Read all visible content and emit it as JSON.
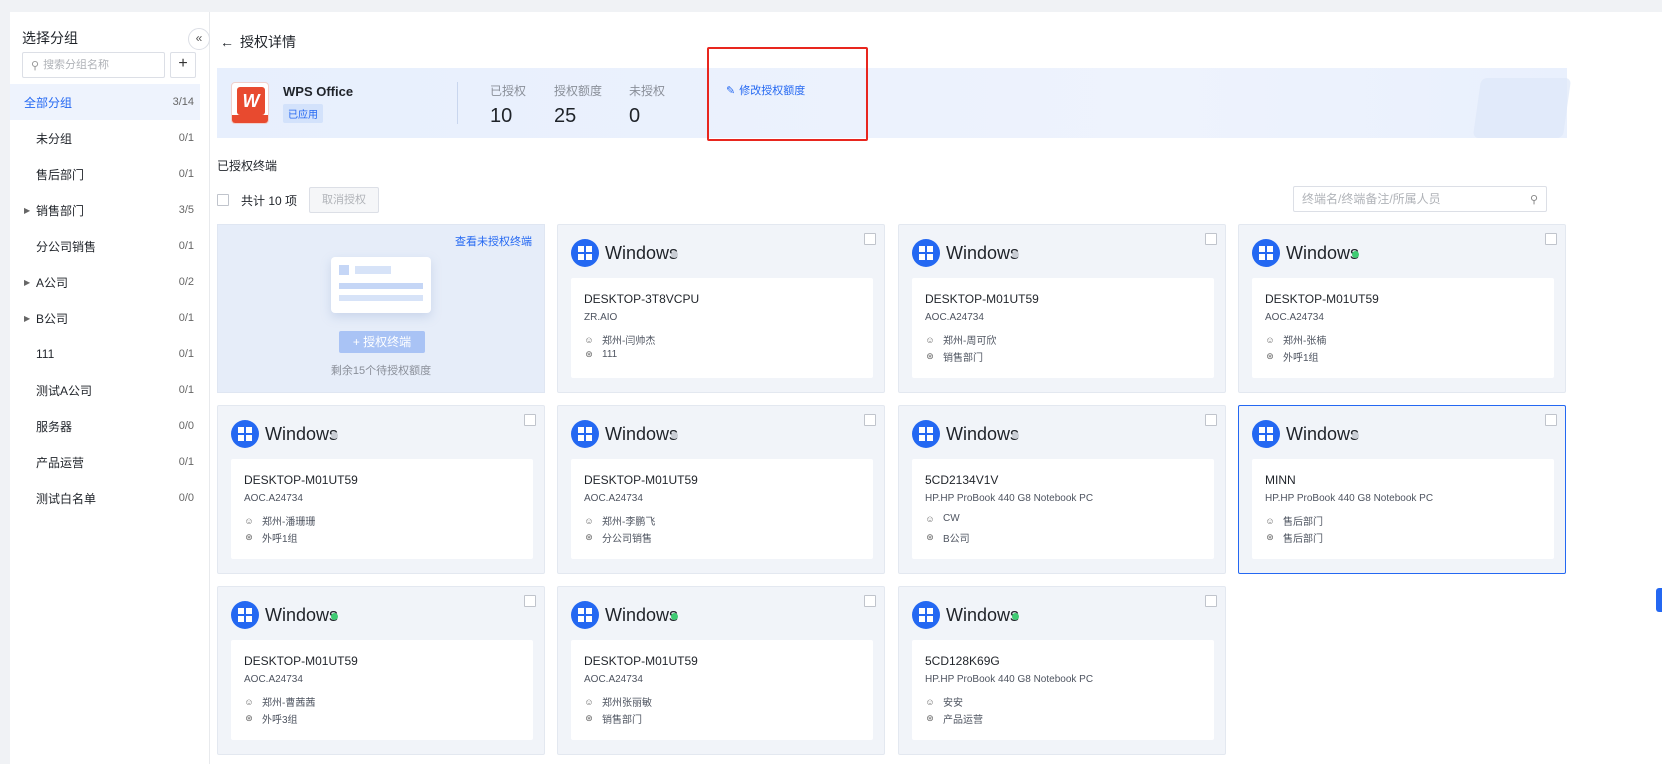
{
  "sidebar": {
    "title": "选择分组",
    "collapse_icon": "«",
    "search_placeholder": "搜索分组名称",
    "add_label": "+",
    "groups": [
      {
        "name": "全部分组",
        "count": "3/14",
        "active": true,
        "expandable": false
      },
      {
        "name": "未分组",
        "count": "0/1",
        "expandable": false
      },
      {
        "name": "售后部门",
        "count": "0/1",
        "expandable": false
      },
      {
        "name": "销售部门",
        "count": "3/5",
        "expandable": true
      },
      {
        "name": "分公司销售",
        "count": "0/1",
        "expandable": false
      },
      {
        "name": "A公司",
        "count": "0/2",
        "expandable": true
      },
      {
        "name": "B公司",
        "count": "0/1",
        "expandable": true
      },
      {
        "name": "111",
        "count": "0/1",
        "expandable": false
      },
      {
        "name": "测试A公司",
        "count": "0/1",
        "expandable": false
      },
      {
        "name": "服务器",
        "count": "0/0",
        "expandable": false
      },
      {
        "name": "产品运营",
        "count": "0/1",
        "expandable": false
      },
      {
        "name": "测试白名单",
        "count": "0/0",
        "expandable": false
      }
    ]
  },
  "header": {
    "back_label": "授权详情"
  },
  "app": {
    "name": "WPS Office",
    "status_tag": "已应用",
    "stats": [
      {
        "label": "已授权",
        "value": "10"
      },
      {
        "label": "授权额度",
        "value": "25"
      },
      {
        "label": "未授权",
        "value": "0"
      }
    ],
    "edit_label": "修改授权额度"
  },
  "section": {
    "title": "已授权终端",
    "total_label": "共计 10 项",
    "cancel_label": "取消授权",
    "search_placeholder": "终端名/终端备注/所属人员"
  },
  "auth_card": {
    "view_link": "查看未授权终端",
    "button_label": "授权终端",
    "note": "剩余15个待授权额度"
  },
  "terminals": [
    {
      "os": "Windows",
      "online": false,
      "host": "DESKTOP-3T8VCPU",
      "model": "ZR.AIO",
      "user": "郑州-闫帅杰",
      "group": "111",
      "selected": false
    },
    {
      "os": "Windows",
      "online": false,
      "host": "DESKTOP-M01UT59",
      "model": "AOC.A24734",
      "user": "郑州-周可欣",
      "group": "销售部门",
      "selected": false
    },
    {
      "os": "Windows",
      "online": true,
      "host": "DESKTOP-M01UT59",
      "model": "AOC.A24734",
      "user": "郑州-张楠",
      "group": "外呼1组",
      "selected": false
    },
    {
      "os": "Windows",
      "online": false,
      "host": "DESKTOP-M01UT59",
      "model": "AOC.A24734",
      "user": "郑州-潘珊珊",
      "group": "外呼1组",
      "selected": false
    },
    {
      "os": "Windows",
      "online": false,
      "host": "DESKTOP-M01UT59",
      "model": "AOC.A24734",
      "user": "郑州-李鹏飞",
      "group": "分公司销售",
      "selected": false
    },
    {
      "os": "Windows",
      "online": false,
      "host": "5CD2134V1V",
      "model": "HP.HP ProBook 440 G8 Notebook PC",
      "user": "CW",
      "group": "B公司",
      "selected": false
    },
    {
      "os": "Windows",
      "online": false,
      "host": "MINN",
      "model": "HP.HP ProBook 440 G8 Notebook PC",
      "user": "售后部门",
      "group": "售后部门",
      "selected": true
    },
    {
      "os": "Windows",
      "online": true,
      "host": "DESKTOP-M01UT59",
      "model": "AOC.A24734",
      "user": "郑州-曹茜茜",
      "group": "外呼3组",
      "selected": false
    },
    {
      "os": "Windows",
      "online": true,
      "host": "DESKTOP-M01UT59",
      "model": "AOC.A24734",
      "user": "郑州张丽敏",
      "group": "销售部门",
      "selected": false
    },
    {
      "os": "Windows",
      "online": true,
      "host": "5CD128K69G",
      "model": "HP.HP ProBook 440 G8 Notebook PC",
      "user": "安安",
      "group": "产品运营",
      "selected": false
    }
  ]
}
